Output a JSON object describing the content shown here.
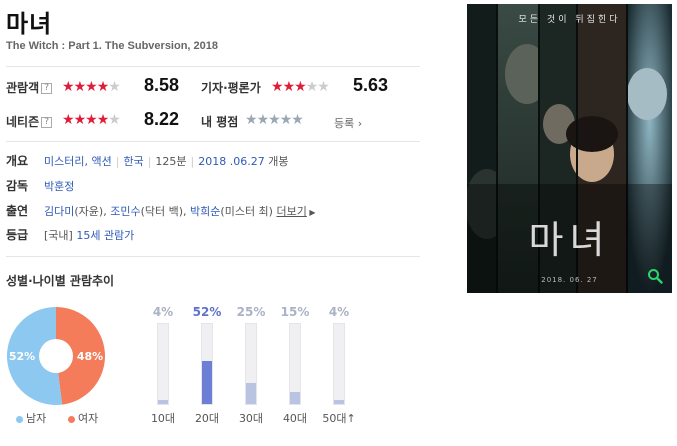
{
  "movie": {
    "title": "마녀",
    "subtitle": "The Witch : Part 1. The Subversion, 2018"
  },
  "ratings": {
    "audience_label": "관람객",
    "audience_score": "8.58",
    "audience_stars_fraction": 0.858,
    "critic_label": "기자·평론가",
    "critic_score": "5.63",
    "critic_stars_fraction": 0.563,
    "netizen_label": "네티즌",
    "netizen_score": "8.22",
    "netizen_stars_fraction": 0.822,
    "my_label": "내 평점",
    "register_label": "등록",
    "help_glyph": "?"
  },
  "info": {
    "overview_label": "개요",
    "genre": "미스터리, 액션",
    "country": "한국",
    "runtime": "125분",
    "release_date": "2018 .06.27",
    "release_suffix": "개봉",
    "director_label": "감독",
    "director": "박훈정",
    "cast_label": "출연",
    "cast": [
      {
        "name": "김다미",
        "role": "(자윤)"
      },
      {
        "name": "조민수",
        "role": "(닥터 백)"
      },
      {
        "name": "박희순",
        "role": "(미스터 최)"
      }
    ],
    "cast_sep": ",",
    "more_label": "더보기",
    "grade_label": "등급",
    "grade_prefix": "[국내]",
    "grade": "15세 관람가"
  },
  "trend": {
    "title": "성별·나이별 관람추이",
    "gender": {
      "male_pct_label": "52%",
      "female_pct_label": "48%",
      "male_share": 0.52,
      "female_share": 0.48,
      "male_label": "남자",
      "female_label": "여자",
      "male_color": "#8cc8f0",
      "female_color": "#f47c5a"
    },
    "ages": [
      {
        "label": "10대",
        "pct_label": "4%",
        "value": 4,
        "highlight": false
      },
      {
        "label": "20대",
        "pct_label": "52%",
        "value": 52,
        "highlight": true
      },
      {
        "label": "30대",
        "pct_label": "25%",
        "value": 25,
        "highlight": false
      },
      {
        "label": "40대",
        "pct_label": "15%",
        "value": 15,
        "highlight": false
      },
      {
        "label": "50대↑",
        "pct_label": "4%",
        "value": 4,
        "highlight": false
      }
    ]
  },
  "poster": {
    "tagline": "모든 것이 뒤집힌다",
    "logo_text": "마녀",
    "date_text": "2018. 06. 27",
    "zoom_icon": "magnifier-icon"
  }
}
